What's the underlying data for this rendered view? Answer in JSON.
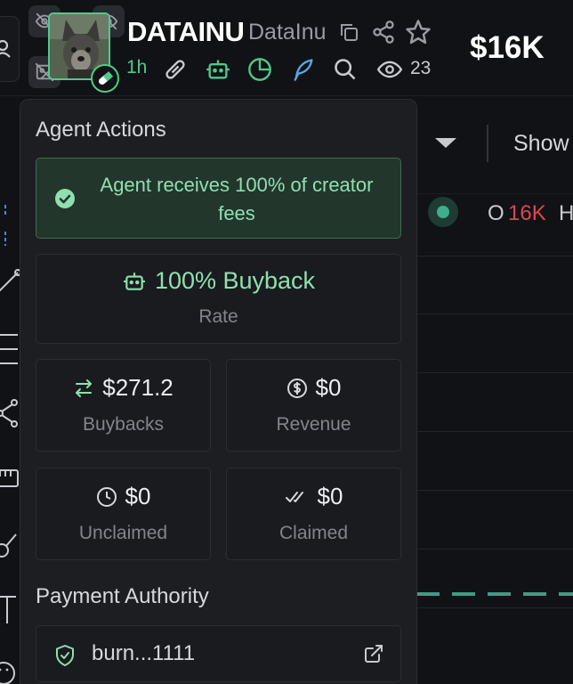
{
  "header": {
    "token_name": "DATAINU",
    "token_symbol": "DataInu",
    "age": "1h",
    "view_count": "23",
    "market_cap": "$16K",
    "accent_color": "#4ecb8c",
    "icons": [
      "copy-icon",
      "share-icon",
      "star-icon",
      "link-icon",
      "robot-icon",
      "pie-chart-icon",
      "feather-icon",
      "search-icon",
      "eye-icon",
      "eye-off-icon",
      "pill-icon"
    ]
  },
  "chart_bg": {
    "show_label": "Show",
    "ohlc_open_label": "O",
    "ohlc_open_value": "16K",
    "ohlc_high_label": "H",
    "down_color": "#e04552",
    "line_color": "#3f9c86"
  },
  "panel": {
    "title": "Agent Actions",
    "notice": "Agent receives 100% of creator fees",
    "rate": {
      "value": "100% Buyback",
      "label": "Rate"
    },
    "stats": [
      {
        "value": "$271.2",
        "label": "Buybacks",
        "icon": "swap-arrows-icon"
      },
      {
        "value": "$0",
        "label": "Revenue",
        "icon": "dollar-circle-icon"
      },
      {
        "value": "$0",
        "label": "Unclaimed",
        "icon": "clock-icon"
      },
      {
        "value": "$0",
        "label": "Claimed",
        "icon": "double-check-icon"
      }
    ],
    "payment_title": "Payment Authority",
    "payment_address": "burn...1111"
  }
}
